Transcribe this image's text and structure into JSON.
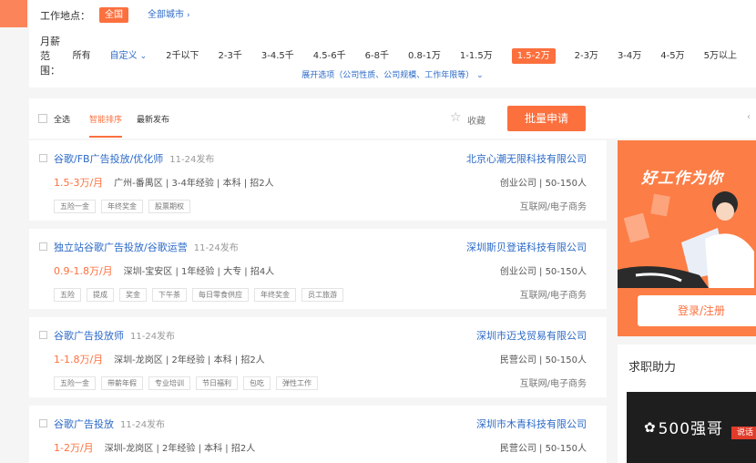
{
  "filters": {
    "location_label": "工作地点：",
    "location_all": "全国",
    "location_cities": "全部城市",
    "salary_label": "月薪范围：",
    "salary_options": [
      {
        "label": "所有",
        "state": "normal"
      },
      {
        "label": "自定义",
        "state": "blue"
      },
      {
        "label": "2千以下",
        "state": "normal"
      },
      {
        "label": "2-3千",
        "state": "normal"
      },
      {
        "label": "3-4.5千",
        "state": "normal"
      },
      {
        "label": "4.5-6千",
        "state": "normal"
      },
      {
        "label": "6-8千",
        "state": "normal"
      },
      {
        "label": "0.8-1万",
        "state": "normal"
      },
      {
        "label": "1-1.5万",
        "state": "normal"
      },
      {
        "label": "1.5-2万",
        "state": "active"
      },
      {
        "label": "2-3万",
        "state": "normal"
      },
      {
        "label": "3-4万",
        "state": "normal"
      },
      {
        "label": "4-5万",
        "state": "normal"
      },
      {
        "label": "5万以上",
        "state": "normal"
      }
    ],
    "expand_label": "展开选项（公司性质、公司规模、工作年限等）"
  },
  "toolbar": {
    "select_all": "全选",
    "tab_smart": "智能排序",
    "tab_latest": "最新发布",
    "favorite": "收藏",
    "batch_apply": "批量申请"
  },
  "jobs": [
    {
      "title": "谷歌/FB广告投放/优化师",
      "date": "11-24发布",
      "salary": "1.5-3万/月",
      "info": "广州-番禺区 | 3-4年经验 | 本科 | 招2人",
      "tags": [
        "五险一金",
        "年终奖金",
        "股票期权"
      ],
      "company": "北京心潮无限科技有限公司",
      "company_info": "创业公司 | 50-150人",
      "industry": "互联网/电子商务"
    },
    {
      "title": "独立站谷歌广告投放/谷歌运营",
      "date": "11-24发布",
      "salary": "0.9-1.8万/月",
      "info": "深圳-宝安区 | 1年经验 | 大专 | 招4人",
      "tags": [
        "五险",
        "提成",
        "奖金",
        "下午茶",
        "每日零食供应",
        "年终奖金",
        "员工旅游"
      ],
      "company": "深圳斯贝登诺科技有限公司",
      "company_info": "创业公司 | 50-150人",
      "industry": "互联网/电子商务"
    },
    {
      "title": "谷歌广告投放师",
      "date": "11-24发布",
      "salary": "1-1.8万/月",
      "info": "深圳-龙岗区 | 2年经验 | 本科 | 招2人",
      "tags": [
        "五险一金",
        "带薪年假",
        "专业培训",
        "节日福利",
        "包吃",
        "弹性工作"
      ],
      "company": "深圳市迈戈贸易有限公司",
      "company_info": "民营公司 | 50-150人",
      "industry": "互联网/电子商务"
    },
    {
      "title": "谷歌广告投放",
      "date": "11-24发布",
      "salary": "1-2万/月",
      "info": "深圳-龙岗区 | 2年经验 | 本科 | 招2人",
      "tags": [],
      "company": "深圳市木青科技有限公司",
      "company_info": "民营公司 | 50-150人",
      "industry": ""
    }
  ],
  "sidebar": {
    "banner_title": "好工作为你",
    "login_button": "登录/注册",
    "help_title": "求职助力",
    "watermark": "500强哥",
    "help_red_text": "说话"
  }
}
